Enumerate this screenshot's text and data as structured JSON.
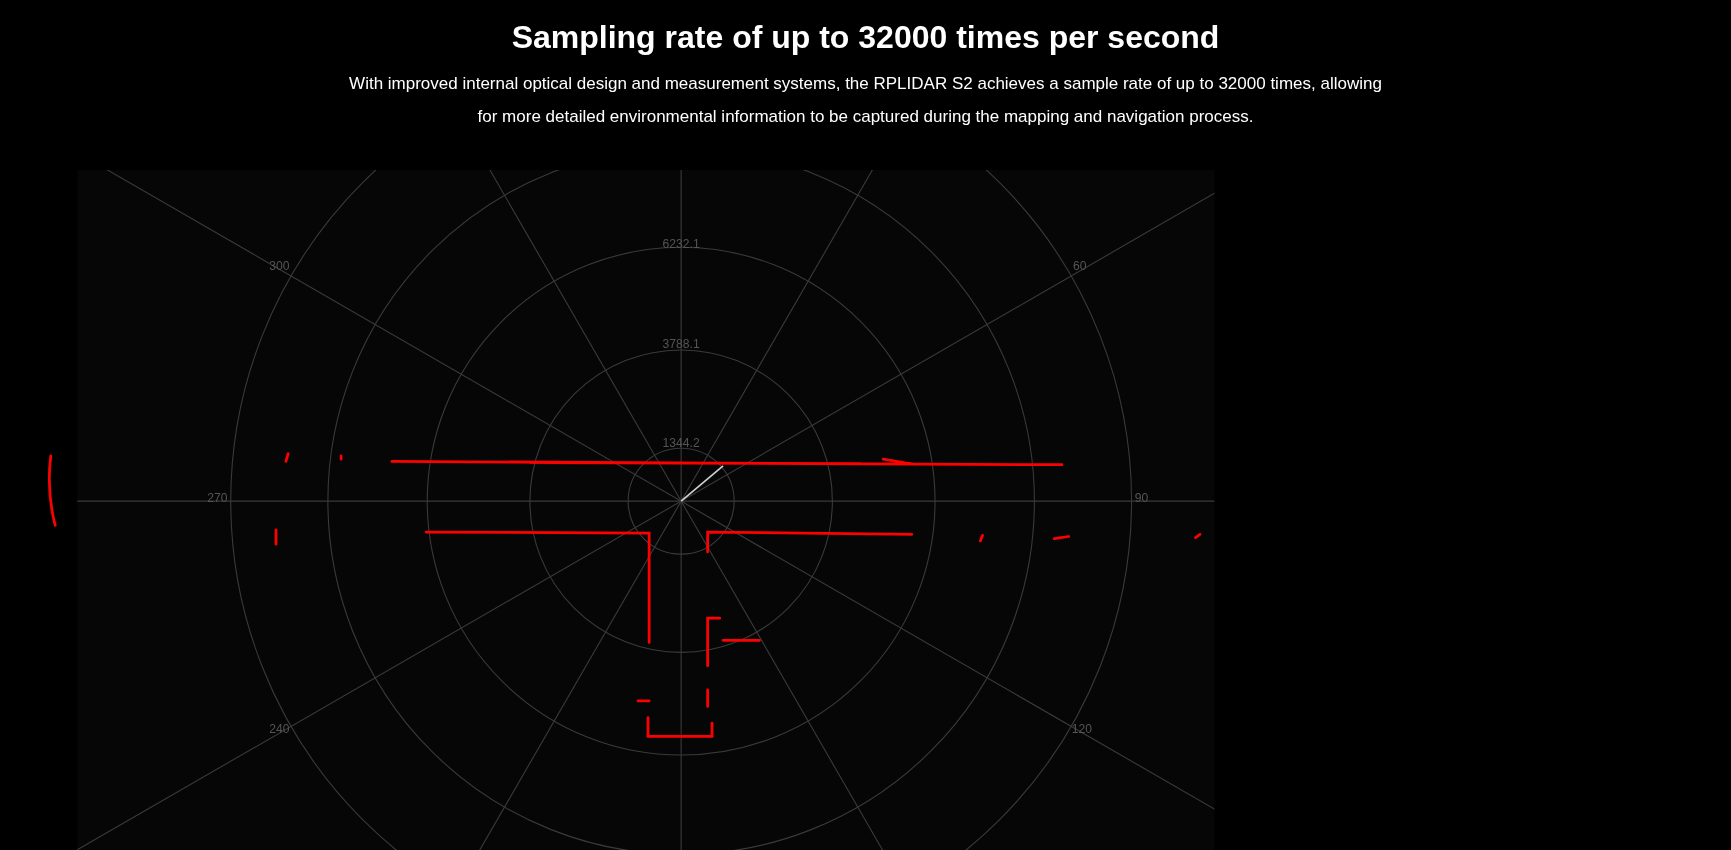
{
  "heading": "Sampling rate of up to 32000 times per second",
  "description": "With improved internal optical design and measurement systems, the RPLIDAR S2 achieves a sample rate of up to 32000 times, allowing for more detailed environmental information to be captured during the mapping and navigation process.",
  "scan_plot": {
    "radial_labels": [
      "6232.1",
      "3788.1",
      "1344.2"
    ],
    "angle_labels": [
      "300",
      "60",
      "270",
      "90",
      "240",
      "120"
    ]
  }
}
